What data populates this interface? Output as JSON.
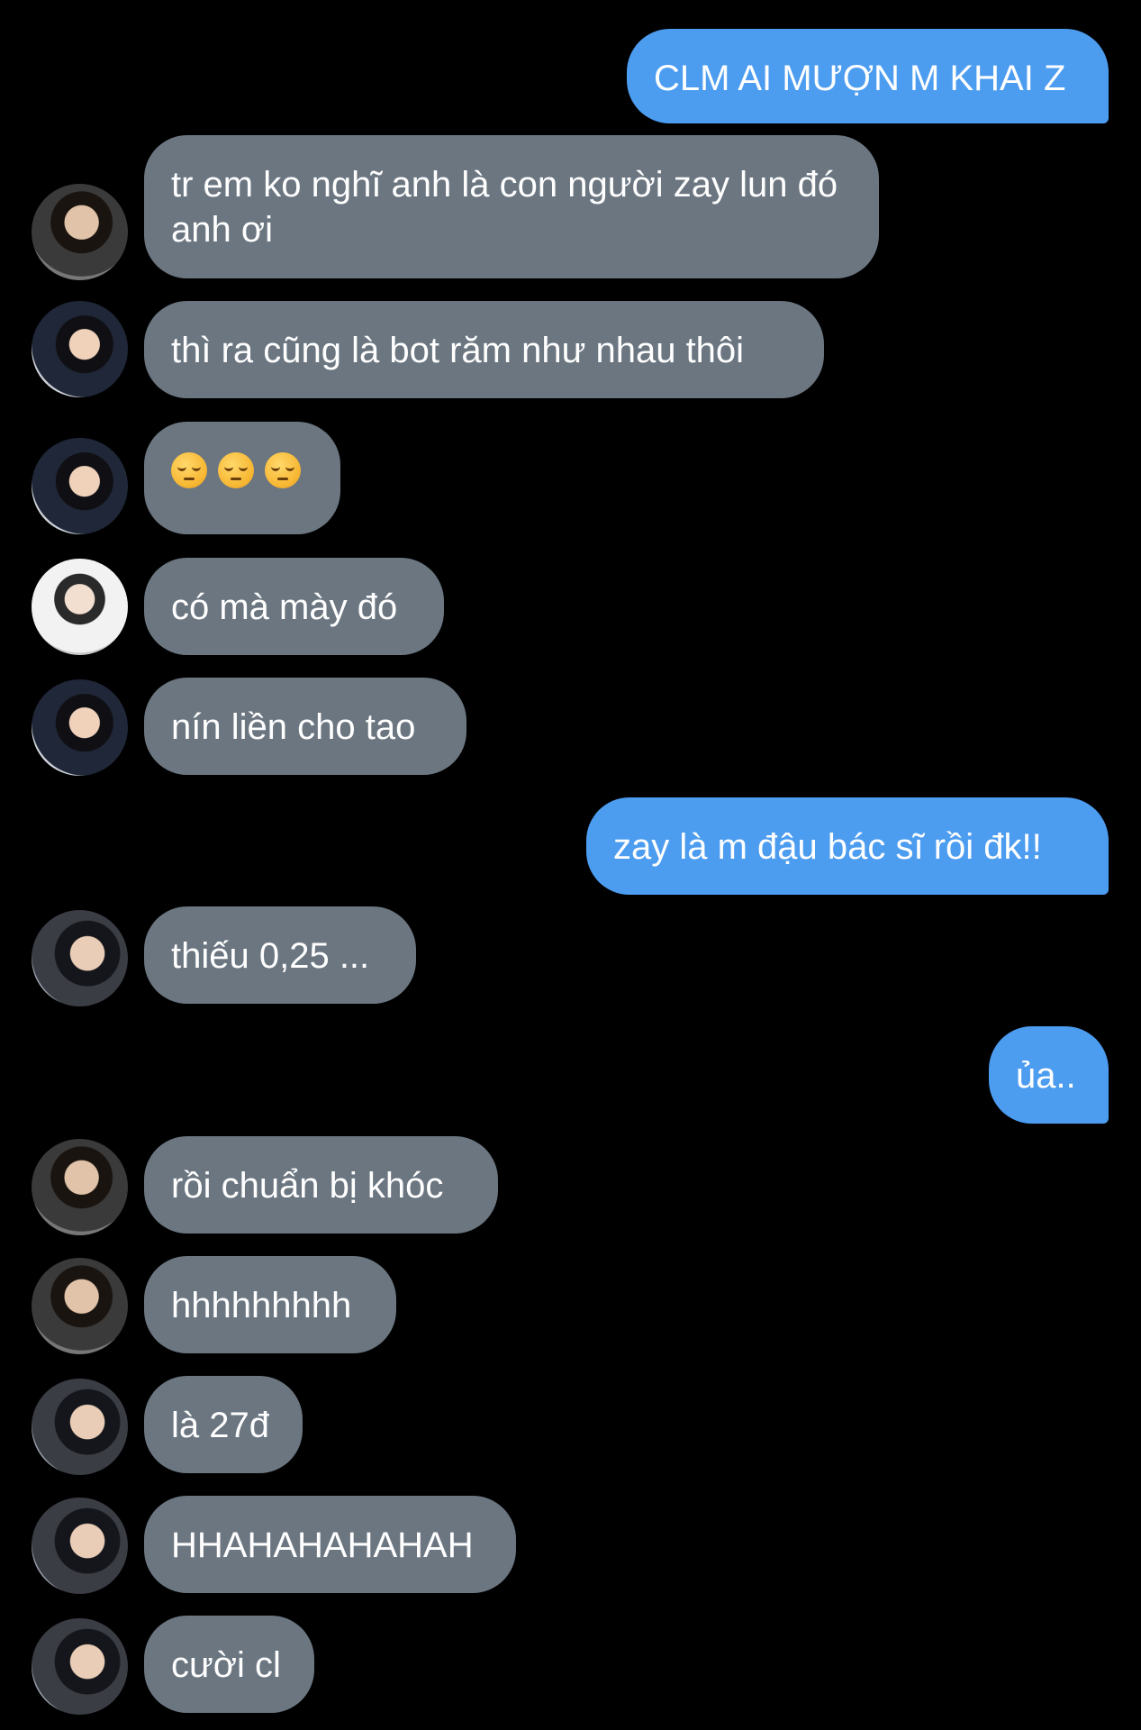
{
  "conversation": {
    "messages": [
      {
        "sender": "me",
        "text": "CLM AI MƯỢN M KHAI Z"
      },
      {
        "sender": "other",
        "avatar": "avatar-a",
        "text": "tr em ko nghĩ anh là con người zay lun đó anh ơi"
      },
      {
        "sender": "other",
        "avatar": "avatar-b",
        "text": "thì ra cũng là bot răm như nhau thôi"
      },
      {
        "sender": "other",
        "avatar": "avatar-b",
        "emojis": [
          "pensive-face-icon",
          "pensive-face-icon",
          "pensive-face-icon"
        ]
      },
      {
        "sender": "other",
        "avatar": "avatar-c",
        "text": "có mà mày đó"
      },
      {
        "sender": "other",
        "avatar": "avatar-b",
        "text": "nín liền cho tao"
      },
      {
        "sender": "me",
        "text": "zay là m đậu bác sĩ rồi đk!!"
      },
      {
        "sender": "other",
        "avatar": "avatar-d",
        "text": "thiếu 0,25 ..."
      },
      {
        "sender": "me",
        "text": "ủa.."
      },
      {
        "sender": "other",
        "avatar": "avatar-a",
        "text": "rồi chuẩn bị khóc"
      },
      {
        "sender": "other",
        "avatar": "avatar-a",
        "text": "hhhhhhhhh"
      },
      {
        "sender": "other",
        "avatar": "avatar-d",
        "text": "là 27đ"
      },
      {
        "sender": "other",
        "avatar": "avatar-d",
        "text": "HHAHAHAHAHAH"
      },
      {
        "sender": "other",
        "avatar": "avatar-d",
        "text": "cười cl"
      }
    ]
  },
  "colors": {
    "background": "#000000",
    "outgoing_bubble": "#4c9cf0",
    "incoming_bubble": "#6b7681",
    "text": "#ffffff"
  }
}
